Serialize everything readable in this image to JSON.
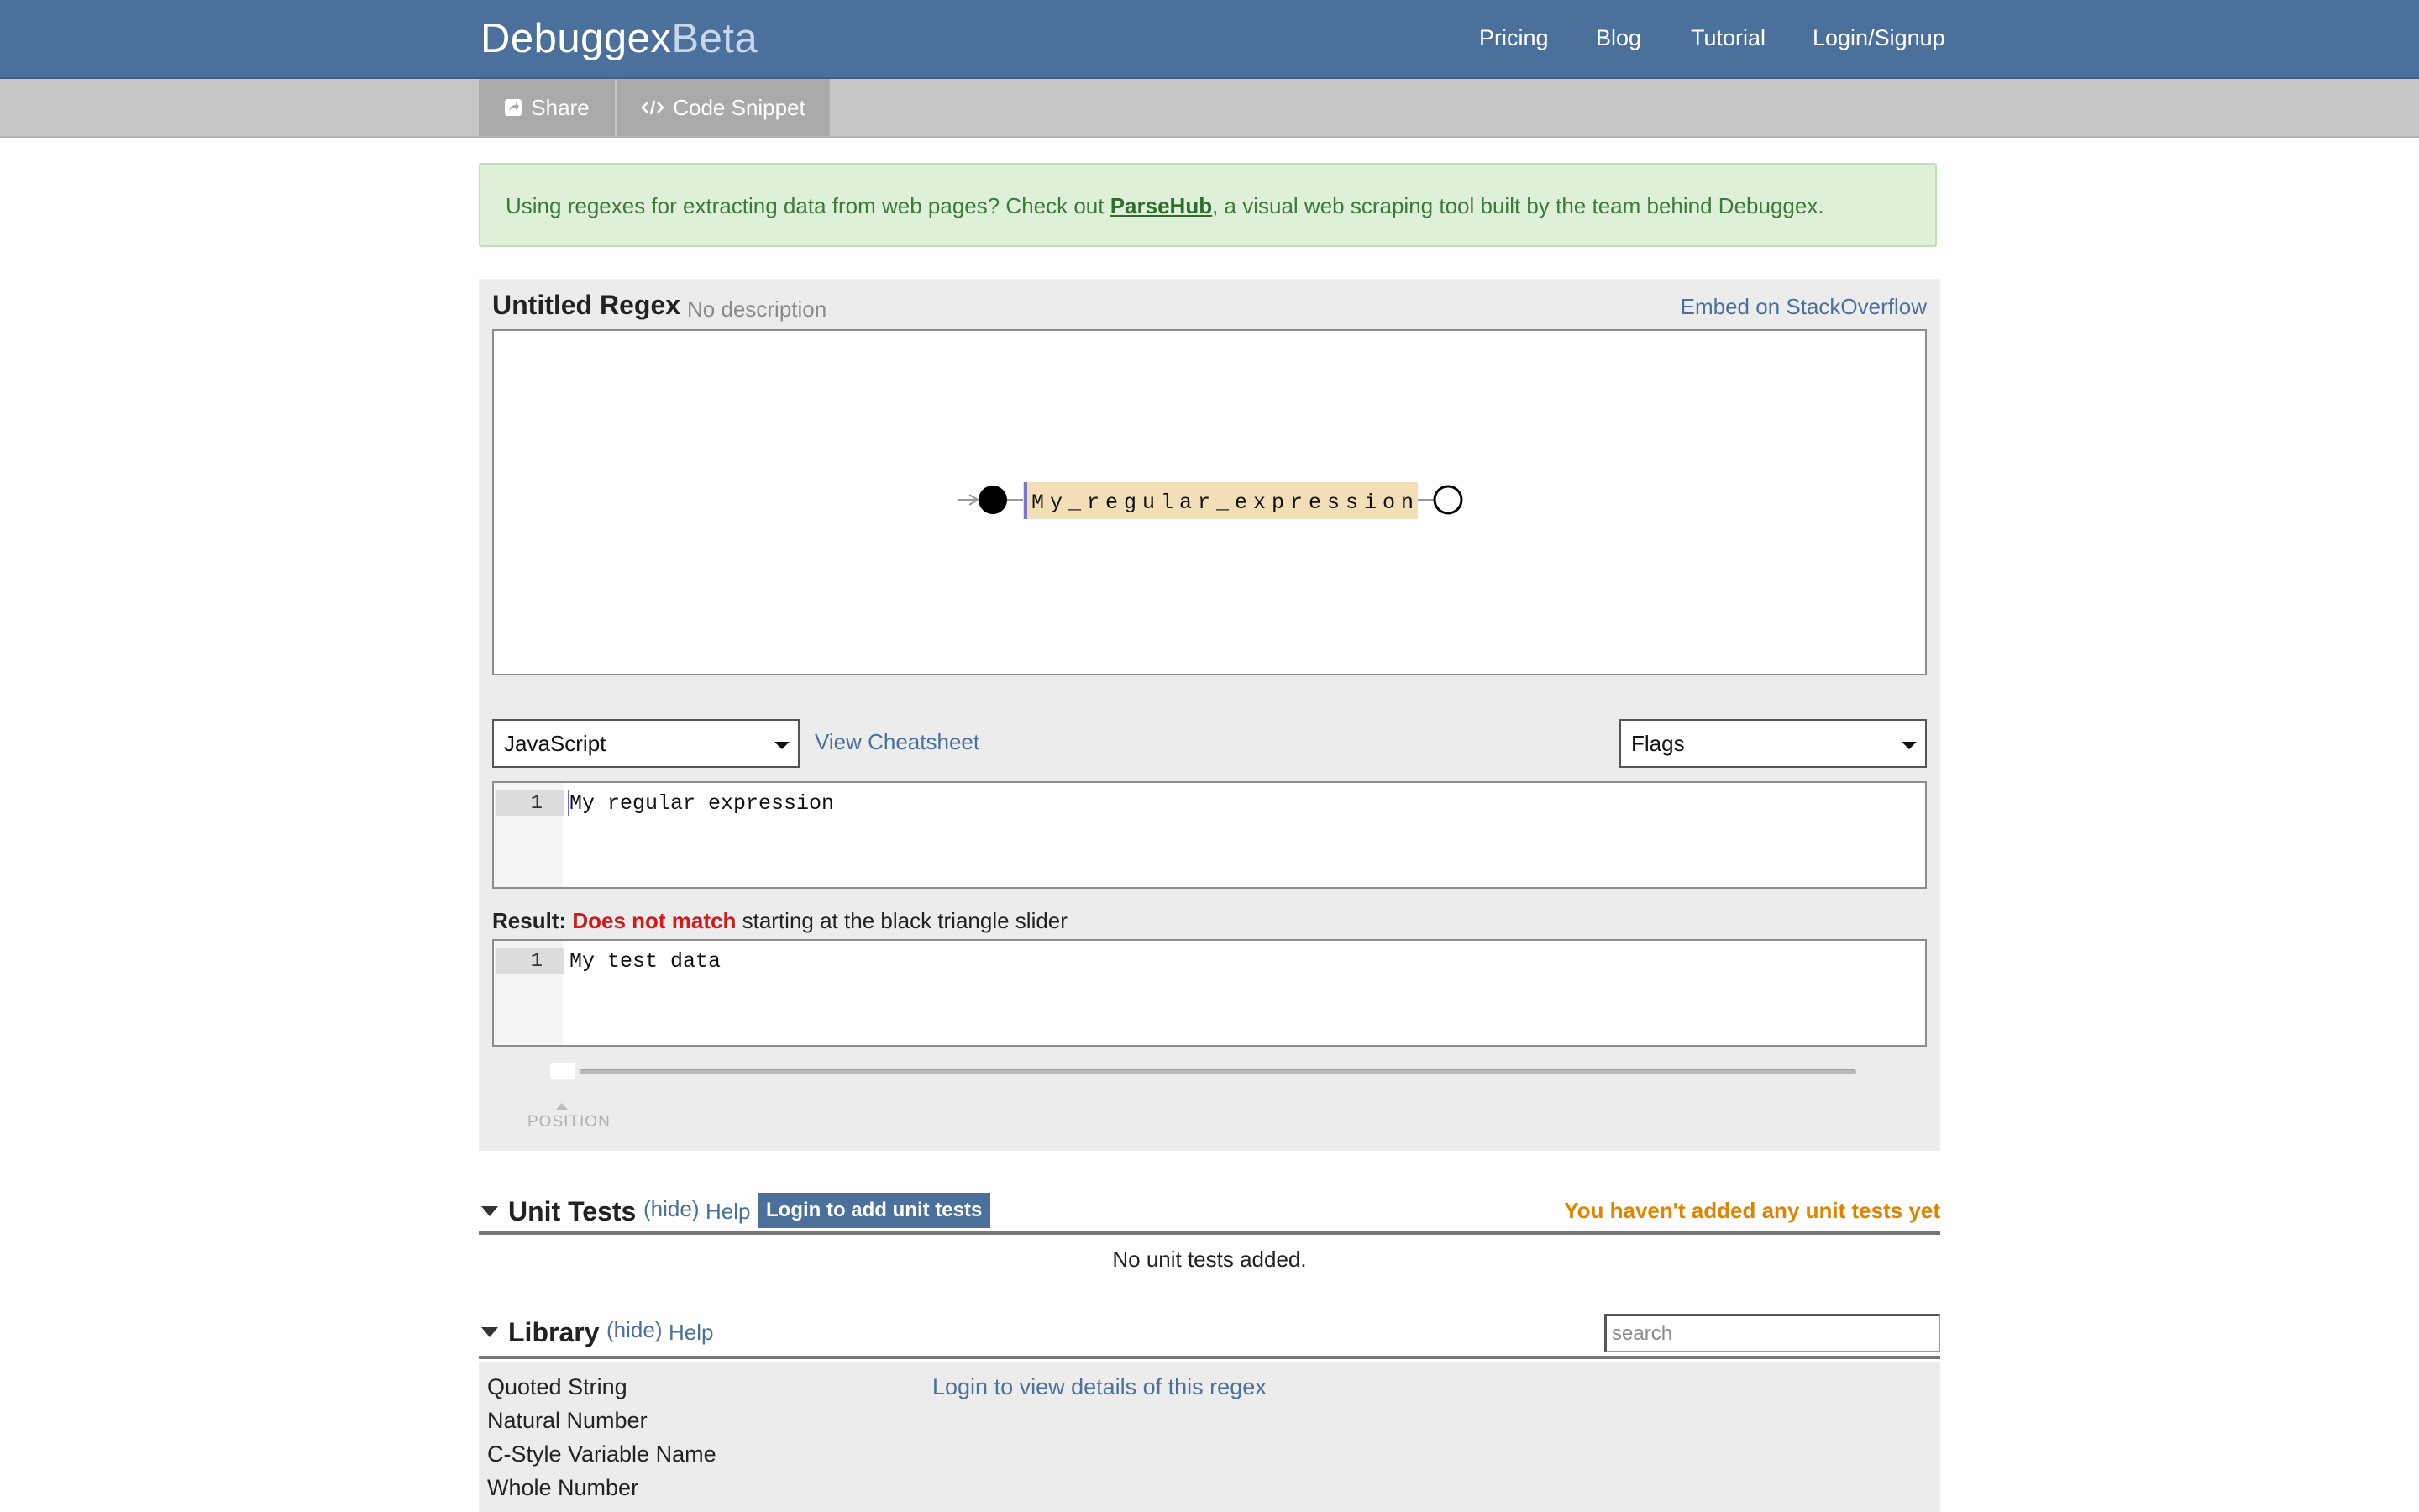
{
  "nav": {
    "brand_main": "Debuggex",
    "brand_suffix": "Beta",
    "links": [
      "Pricing",
      "Blog",
      "Tutorial",
      "Login/Signup"
    ]
  },
  "toolbar": {
    "share_label": "Share",
    "snippet_label": "Code Snippet"
  },
  "promo": {
    "before": "Using regexes for extracting data from web pages? Check out ",
    "link": "ParseHub",
    "after": ", a visual web scraping tool built by the team behind Debuggex."
  },
  "editor": {
    "title": "Untitled Regex",
    "description": "No description",
    "embed_link": "Embed on StackOverflow",
    "diagram_literal": "My_regular_expression",
    "flavor": "JavaScript",
    "cheatsheet_link": "View Cheatsheet",
    "flags": "Flags",
    "regex_line_number": "1",
    "regex": "My regular expression",
    "result_label": "Result:",
    "result_status": "Does not match",
    "result_tail": " starting at the black triangle slider",
    "test_line_number": "1",
    "test_data": "My test data",
    "slider_label": "POSITION",
    "slider_position": 0
  },
  "unit_tests": {
    "title": "Unit Tests",
    "hide": "(hide)",
    "help": "Help",
    "login_button": "Login to add unit tests",
    "warning": "You haven't added any unit tests yet",
    "empty": "No unit tests added."
  },
  "library": {
    "title": "Library",
    "hide": "(hide)",
    "help": "Help",
    "search_placeholder": "search",
    "items": [
      "Quoted String",
      "Natural Number",
      "C-Style Variable Name",
      "Whole Number"
    ],
    "details_link": "Login to view details of this regex"
  },
  "colors": {
    "header": "#4a709b",
    "link": "#4a709b",
    "no_match": "#d11a1a",
    "warning": "#e08400",
    "promo_bg": "#dff0d8",
    "literal_bg": "#f2dfb8"
  }
}
